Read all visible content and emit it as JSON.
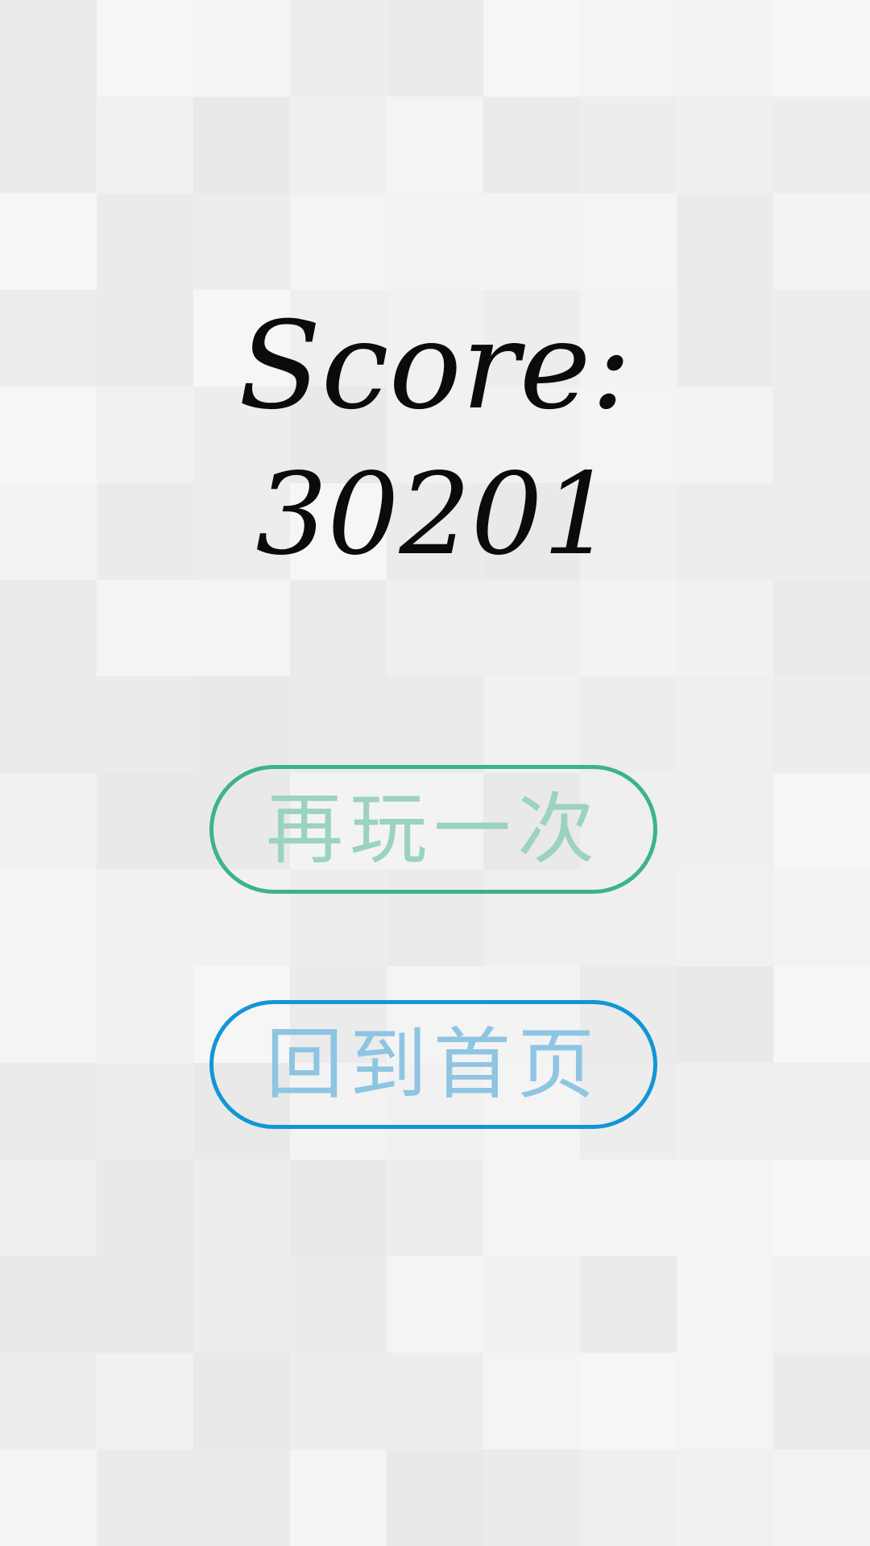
{
  "score": {
    "label": "Score:",
    "value": "30201"
  },
  "buttons": {
    "replay": {
      "label": "再玩一次",
      "border_color": "#3db38a",
      "text_color": "#9bd3bd"
    },
    "home": {
      "label": "回到首页",
      "border_color": "#1296d6",
      "text_color": "#8ec5e3"
    }
  },
  "background": {
    "tile_colors": [
      "#f4f4f4",
      "#ededed",
      "#f1f1f1",
      "#ebebeb",
      "#f6f6f6",
      "#efefef",
      "#e9e9e9",
      "#f3f3f3"
    ]
  }
}
